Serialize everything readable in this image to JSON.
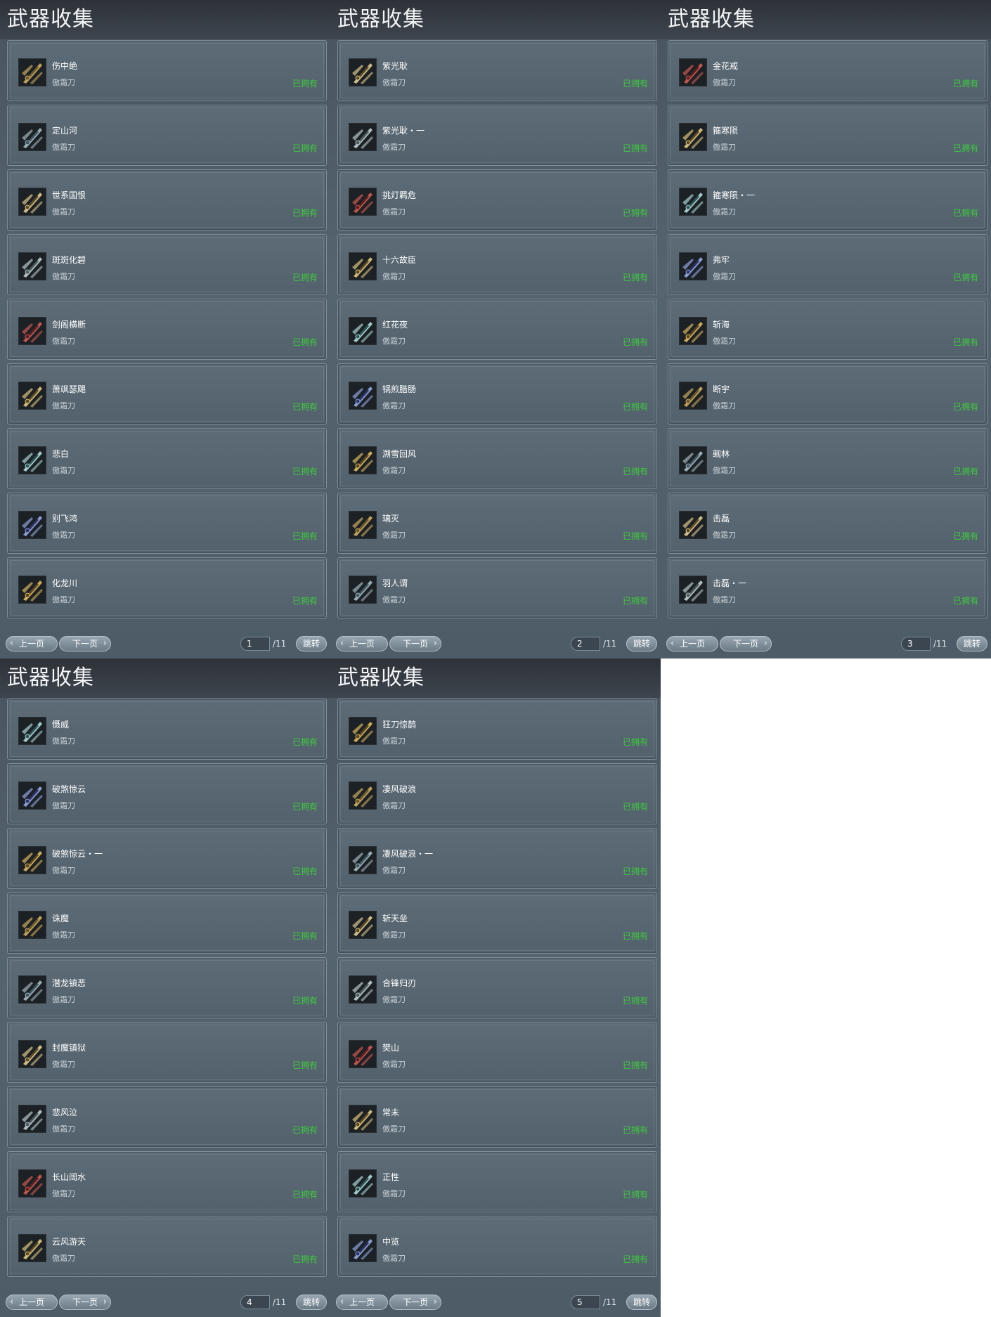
{
  "pages": [
    {
      "title": "武器收集",
      "items": [
        {
          "name": "伤中绝",
          "type": "傲霜刀",
          "status": "已拥有"
        },
        {
          "name": "定山河",
          "type": "傲霜刀",
          "status": "已拥有"
        },
        {
          "name": "世系国恨",
          "type": "傲霜刀",
          "status": "已拥有"
        },
        {
          "name": "斑斑化碧",
          "type": "傲霜刀",
          "status": "已拥有"
        },
        {
          "name": "剑阁横断",
          "type": "傲霜刀",
          "status": "已拥有"
        },
        {
          "name": "萧飒瑟飓",
          "type": "傲霜刀",
          "status": "已拥有"
        },
        {
          "name": "悲白",
          "type": "傲霜刀",
          "status": "已拥有"
        },
        {
          "name": "别飞鸿",
          "type": "傲霜刀",
          "status": "已拥有"
        },
        {
          "name": "化龙川",
          "type": "傲霜刀",
          "status": "已拥有"
        }
      ],
      "pager": {
        "prev": "上一页",
        "next": "下一页",
        "page": "1",
        "total": "/11",
        "go": "跳转"
      }
    },
    {
      "title": "武器收集",
      "items": [
        {
          "name": "紫光耿",
          "type": "傲霜刀",
          "status": "已拥有"
        },
        {
          "name": "紫光耿・一",
          "type": "傲霜刀",
          "status": "已拥有"
        },
        {
          "name": "挑灯羁危",
          "type": "傲霜刀",
          "status": "已拥有"
        },
        {
          "name": "十六故臣",
          "type": "傲霜刀",
          "status": "已拥有"
        },
        {
          "name": "红花夜",
          "type": "傲霜刀",
          "status": "已拥有"
        },
        {
          "name": "锅煎腊肠",
          "type": "傲霜刀",
          "status": "已拥有"
        },
        {
          "name": "溯雪回风",
          "type": "傲霜刀",
          "status": "已拥有"
        },
        {
          "name": "璃灭",
          "type": "傲霜刀",
          "status": "已拥有"
        },
        {
          "name": "羽人谓",
          "type": "傲霜刀",
          "status": "已拥有"
        }
      ],
      "pager": {
        "prev": "上一页",
        "next": "下一页",
        "page": "2",
        "total": "/11",
        "go": "跳转"
      }
    },
    {
      "title": "武器收集",
      "items": [
        {
          "name": "金花戒",
          "type": "傲霜刀",
          "status": "已拥有"
        },
        {
          "name": "箍寒陨",
          "type": "傲霜刀",
          "status": "已拥有"
        },
        {
          "name": "箍寒陨・一",
          "type": "傲霜刀",
          "status": "已拥有"
        },
        {
          "name": "弗牢",
          "type": "傲霜刀",
          "status": "已拥有"
        },
        {
          "name": "斩海",
          "type": "傲霜刀",
          "status": "已拥有"
        },
        {
          "name": "断宇",
          "type": "傲霜刀",
          "status": "已拥有"
        },
        {
          "name": "觋林",
          "type": "傲霜刀",
          "status": "已拥有"
        },
        {
          "name": "击磊",
          "type": "傲霜刀",
          "status": "已拥有"
        },
        {
          "name": "击磊・一",
          "type": "傲霜刀",
          "status": "已拥有"
        }
      ],
      "pager": {
        "prev": "上一页",
        "next": "下一页",
        "page": "3",
        "total": "/11",
        "go": "跳转"
      }
    },
    {
      "title": "武器收集",
      "items": [
        {
          "name": "慑威",
          "type": "傲霜刀",
          "status": "已拥有"
        },
        {
          "name": "破煞惊云",
          "type": "傲霜刀",
          "status": "已拥有"
        },
        {
          "name": "破煞惊云・一",
          "type": "傲霜刀",
          "status": "已拥有"
        },
        {
          "name": "诛魔",
          "type": "傲霜刀",
          "status": "已拥有"
        },
        {
          "name": "潜龙镇恶",
          "type": "傲霜刀",
          "status": "已拥有"
        },
        {
          "name": "封魔镇狱",
          "type": "傲霜刀",
          "status": "已拥有"
        },
        {
          "name": "悲风泣",
          "type": "傲霜刀",
          "status": "已拥有"
        },
        {
          "name": "长山阔水",
          "type": "傲霜刀",
          "status": "已拥有"
        },
        {
          "name": "云风游天",
          "type": "傲霜刀",
          "status": "已拥有"
        }
      ],
      "pager": {
        "prev": "上一页",
        "next": "下一页",
        "page": "4",
        "total": "/11",
        "go": "跳转"
      }
    },
    {
      "title": "武器收集",
      "items": [
        {
          "name": "狂刀惊鹊",
          "type": "傲霜刀",
          "status": "已拥有"
        },
        {
          "name": "凄风破浪",
          "type": "傲霜刀",
          "status": "已拥有"
        },
        {
          "name": "凄风破浪・一",
          "type": "傲霜刀",
          "status": "已拥有"
        },
        {
          "name": "斩天垒",
          "type": "傲霜刀",
          "status": "已拥有"
        },
        {
          "name": "合锋归刃",
          "type": "傲霜刀",
          "status": "已拥有"
        },
        {
          "name": "樊山",
          "type": "傲霜刀",
          "status": "已拥有"
        },
        {
          "name": "常未",
          "type": "傲霜刀",
          "status": "已拥有"
        },
        {
          "name": "正性",
          "type": "傲霜刀",
          "status": "已拥有"
        },
        {
          "name": "中览",
          "type": "傲霜刀",
          "status": "已拥有"
        }
      ],
      "pager": {
        "prev": "上一页",
        "next": "下一页",
        "page": "5",
        "total": "/11",
        "go": "跳转"
      }
    }
  ],
  "icon_names": [
    "weapon-blade-icon"
  ],
  "colors": {
    "owned_status": "#3ccb3c"
  }
}
